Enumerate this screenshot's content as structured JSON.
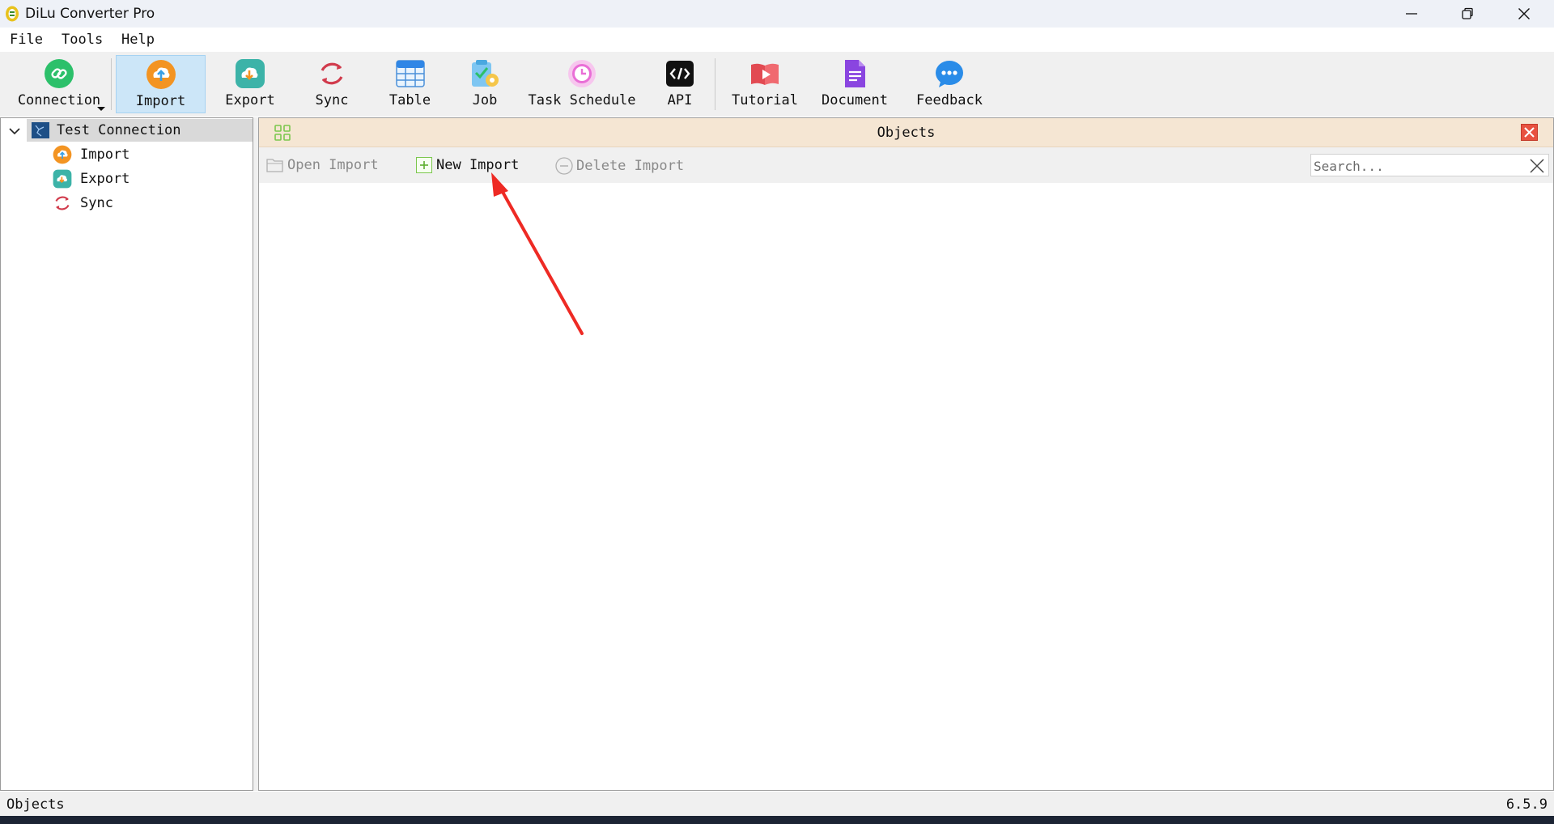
{
  "window": {
    "title": "DiLu Converter Pro",
    "controls": [
      "minimize",
      "restore",
      "close"
    ]
  },
  "menu": {
    "items": [
      "File",
      "Tools",
      "Help"
    ]
  },
  "toolbar": {
    "items": [
      {
        "label": "Connection",
        "icon": "connection-icon",
        "has_dropdown": true
      },
      {
        "label": "Import",
        "icon": "import-icon",
        "active": true
      },
      {
        "label": "Export",
        "icon": "export-icon"
      },
      {
        "label": "Sync",
        "icon": "sync-icon"
      },
      {
        "label": "Table",
        "icon": "table-icon"
      },
      {
        "label": "Job",
        "icon": "job-icon"
      },
      {
        "label": "Task Schedule",
        "icon": "task-schedule-icon"
      },
      {
        "label": "API",
        "icon": "api-icon"
      },
      {
        "label": "Tutorial",
        "icon": "tutorial-icon"
      },
      {
        "label": "Document",
        "icon": "document-icon"
      },
      {
        "label": "Feedback",
        "icon": "feedback-icon"
      }
    ]
  },
  "tree": {
    "root": {
      "label": "Test Connection",
      "expanded": true
    },
    "children": [
      {
        "label": "Import",
        "icon": "import-icon"
      },
      {
        "label": "Export",
        "icon": "export-icon"
      },
      {
        "label": "Sync",
        "icon": "sync-icon"
      }
    ]
  },
  "objects_panel": {
    "title": "Objects",
    "actions": [
      {
        "label": "Open Import",
        "enabled": false,
        "icon": "folder-icon"
      },
      {
        "label": "New Import",
        "enabled": true,
        "icon": "plus-icon"
      },
      {
        "label": "Delete Import",
        "enabled": false,
        "icon": "minus-icon"
      }
    ],
    "search": {
      "placeholder": "Search...",
      "value": ""
    }
  },
  "status": {
    "left": "Objects",
    "version": "6.5.9"
  },
  "colors": {
    "accent_active": "#cce6f8",
    "objects_header": "#f5e6d3",
    "annotation_arrow": "#ee2a24"
  }
}
